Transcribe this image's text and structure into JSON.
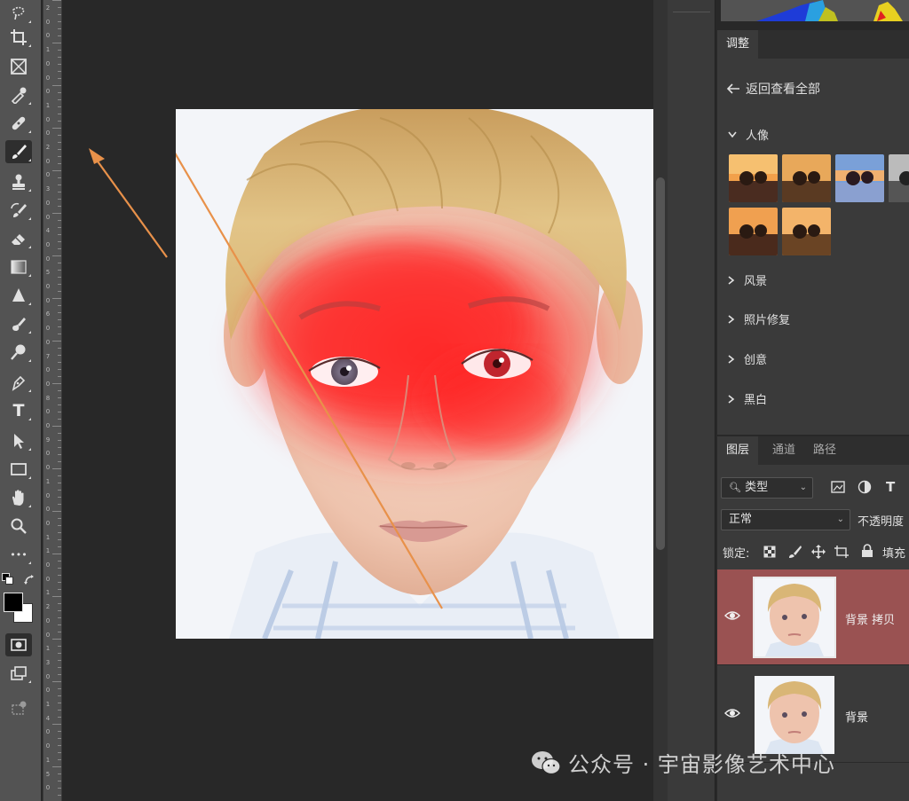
{
  "toolbar": {
    "tools": [
      "lasso-select-icon",
      "crop-icon",
      "frame-icon",
      "eyedropper-icon",
      "spot-healing-icon",
      "brush-icon",
      "clone-stamp-icon",
      "history-brush-icon",
      "eraser-icon",
      "gradient-icon",
      "blur-icon",
      "smudge-icon",
      "dodge-icon",
      "pen-icon",
      "type-icon",
      "path-select-icon",
      "rectangle-icon",
      "hand-icon",
      "zoom-icon",
      "more-icon"
    ],
    "active_tool": "brush-icon",
    "type_glyph": "T",
    "more_glyph": "•••"
  },
  "ruler": {
    "labels": [
      "2",
      "0",
      "0",
      "1",
      "0",
      "0",
      "0",
      "1",
      "0",
      "0",
      "2",
      "0",
      "0",
      "3",
      "0",
      "0",
      "4",
      "0",
      "0",
      "5",
      "0",
      "0",
      "6",
      "0",
      "0",
      "7",
      "0",
      "0",
      "8",
      "0",
      "0",
      "9",
      "0",
      "0",
      "1",
      "0",
      "0",
      "0",
      "1",
      "1",
      "0",
      "0",
      "1",
      "2",
      "0",
      "0",
      "1",
      "3",
      "0",
      "0",
      "1",
      "4",
      "0",
      "0",
      "1",
      "5",
      "0"
    ]
  },
  "adjustments": {
    "tabs": [
      "调整"
    ],
    "back_label": "返回查看全部",
    "sections": [
      {
        "label": "人像",
        "expanded": true
      },
      {
        "label": "风景",
        "expanded": false
      },
      {
        "label": "照片修复",
        "expanded": false
      },
      {
        "label": "创意",
        "expanded": false
      },
      {
        "label": "黑白",
        "expanded": false
      }
    ]
  },
  "layers_panel": {
    "tabs": [
      "图层",
      "通道",
      "路径"
    ],
    "filter_label": "类型",
    "blend_mode": "正常",
    "opacity_label": "不透明度",
    "lock_label": "锁定:",
    "fill_label": "填充",
    "layers": [
      {
        "name": "背景 拷贝",
        "selected": true
      },
      {
        "name": "背景",
        "selected": false
      }
    ]
  },
  "watermark": {
    "text": "公众号 · 宇宙影像艺术中心"
  },
  "colors": {
    "accent_selected_layer": "#9a5252",
    "annotation_arrow": "#e8914a",
    "paint_overlay": "#ff2a2a"
  }
}
